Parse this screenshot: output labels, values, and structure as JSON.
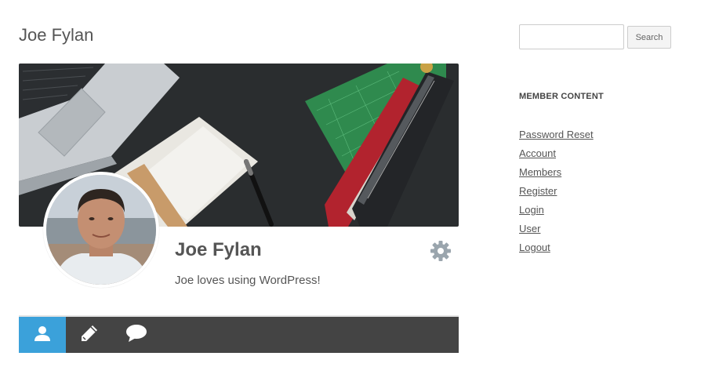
{
  "page": {
    "title": "Joe Fylan"
  },
  "profile": {
    "name": "Joe Fylan",
    "description": "Joe loves using WordPress!",
    "settings_icon": "gear-icon",
    "cover_image": "desk-with-laptop-notebook-books-photo",
    "avatar_image": "man-profile-photo"
  },
  "profile_nav": {
    "items": [
      {
        "icon": "user-icon",
        "active": true
      },
      {
        "icon": "pencil-icon",
        "active": false
      },
      {
        "icon": "comment-icon",
        "active": false
      }
    ],
    "active_color": "#3ba1da",
    "bar_color": "#444444"
  },
  "sidebar": {
    "search": {
      "value": "",
      "placeholder": "",
      "button_label": "Search"
    },
    "widget": {
      "title": "MEMBER CONTENT",
      "links": [
        "Password Reset",
        "Account",
        "Members",
        "Register",
        "Login",
        "User",
        "Logout"
      ]
    }
  }
}
